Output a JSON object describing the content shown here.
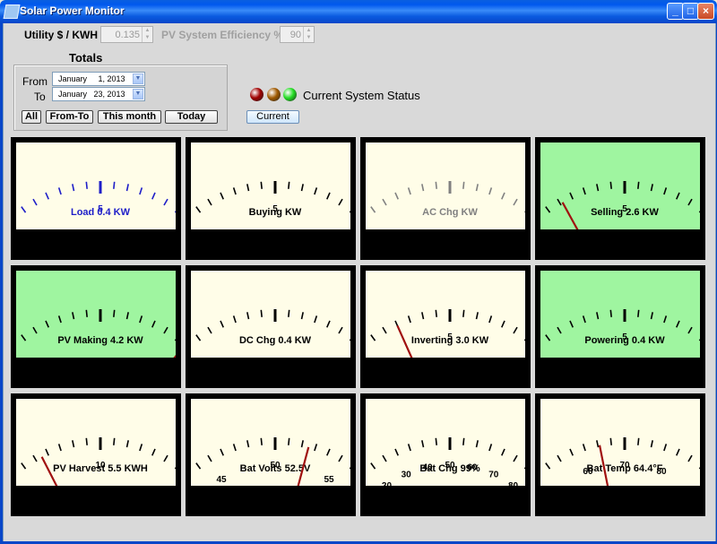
{
  "window": {
    "title": "Solar Power Monitor",
    "controls": [
      "minimize",
      "maximize",
      "close"
    ]
  },
  "settings": {
    "utility_label": "Utility $ / KWH",
    "utility_value": "0.135",
    "efficiency_label": "PV System Efficiency %",
    "efficiency_value": "90"
  },
  "totals": {
    "title": "Totals",
    "from_label": "From",
    "to_label": "To",
    "from_date": "January     1, 2013",
    "to_date": "January   23, 2013",
    "buttons": {
      "all": "All",
      "from_to": "From-To",
      "this_month": "This month",
      "today": "Today"
    }
  },
  "status": {
    "label": "Current System Status",
    "current_button": "Current",
    "leds": [
      {
        "name": "red",
        "color": "#a00000"
      },
      {
        "name": "amber",
        "color": "#a05a00"
      },
      {
        "name": "green",
        "color": "#22dd22"
      }
    ]
  },
  "colors": {
    "face": "#fffde8",
    "face_highlight": "#9ff5a0",
    "needle": "#a01010",
    "frame": "#000000"
  },
  "gauges": [
    {
      "label": "Load 0.4 KW",
      "value": 0.4,
      "min": 0,
      "max": 10,
      "ticks": [
        "0",
        "5",
        "10"
      ],
      "color": "#1e1ec8",
      "highlight": false
    },
    {
      "label": "Buying KW",
      "value": 0,
      "min": 0,
      "max": 10,
      "ticks": [
        "0",
        "5",
        "10"
      ],
      "color": "#000000",
      "highlight": false
    },
    {
      "label": "AC Chg KW",
      "value": 0,
      "min": 0,
      "max": 5,
      "ticks": [
        "0",
        "5"
      ],
      "color": "#808080",
      "highlight": false
    },
    {
      "label": "Selling 2.6 KW",
      "value": 2.6,
      "min": 0,
      "max": 10,
      "ticks": [
        "0",
        "5",
        "10"
      ],
      "color": "#000000",
      "highlight": true
    },
    {
      "label": "PV Making 4.2 KW",
      "value": 4.2,
      "min": 0,
      "max": 5,
      "ticks": [
        "0",
        "5"
      ],
      "color": "#000000",
      "highlight": true
    },
    {
      "label": "DC Chg 0.4 KW",
      "value": 0.4,
      "min": 0,
      "max": 5,
      "ticks": [
        "0",
        "5"
      ],
      "color": "#000000",
      "highlight": false
    },
    {
      "label": "Inverting 3.0 KW",
      "value": 3.0,
      "min": 0,
      "max": 10,
      "ticks": [
        "0",
        "5",
        "10"
      ],
      "color": "#000000",
      "highlight": false
    },
    {
      "label": "Powering 0.4 KW",
      "value": 0.4,
      "min": 0,
      "max": 10,
      "ticks": [
        "0",
        "5",
        "10"
      ],
      "color": "#000000",
      "highlight": true
    },
    {
      "label": "PV Harvest 5.5 KWH",
      "value": 5.5,
      "min": 0,
      "max": 20,
      "ticks": [
        "0",
        "10",
        "20"
      ],
      "color": "#000000",
      "highlight": false
    },
    {
      "label": "Bat Volts 52.5V",
      "value": 52.5,
      "min": 40,
      "max": 60,
      "ticks": [
        "40",
        "45",
        "50",
        "55",
        "60"
      ],
      "color": "#000000",
      "highlight": false
    },
    {
      "label": "Bat Chg 99%",
      "value": 99,
      "min": 0,
      "max": 100,
      "ticks": [
        "0",
        "10",
        "20",
        "30",
        "40",
        "50",
        "60",
        "70",
        "80",
        "90",
        "100"
      ],
      "color": "#000000",
      "highlight": false
    },
    {
      "label": "Bat Temp 64.4°F",
      "value": 64.4,
      "min": 40,
      "max": 100,
      "ticks": [
        "40",
        "50",
        "60",
        "70",
        "80",
        "90",
        "100"
      ],
      "color": "#000000",
      "highlight": false
    }
  ]
}
